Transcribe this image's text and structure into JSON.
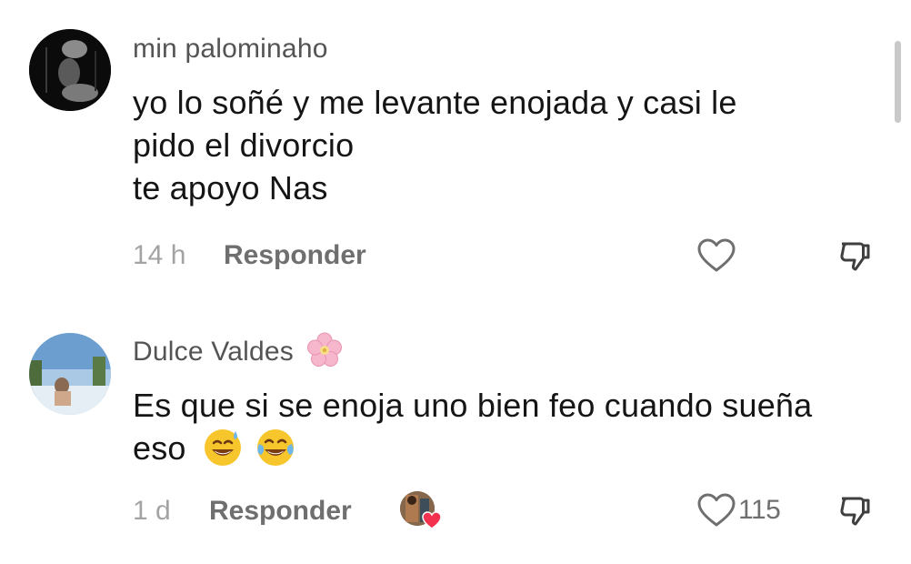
{
  "comments": [
    {
      "username": "min palominaho",
      "lines": [
        "yo lo soñé y me levante enojada y casi le",
        "pido el divorcio",
        "te apoyo Nas"
      ],
      "time": "14 h",
      "reply_label": "Responder",
      "like_count": ""
    },
    {
      "username": "Dulce Valdes",
      "username_emoji": "cherry-blossom-icon",
      "lines": [
        "Es que si se enoja uno bien feo cuando sueña",
        "eso"
      ],
      "line_emojis": [
        "grinning-sweat-emoji",
        "tears-of-joy-emoji"
      ],
      "time": "1 d",
      "reply_label": "Responder",
      "like_count": "115",
      "creator_liked": true
    }
  ],
  "colors": {
    "username": "#545454",
    "body": "#151515",
    "time": "#a3a3a3",
    "reply": "#6f6f6f",
    "heart_badge": "#f2324f",
    "scrollbar": "#c9c9c9"
  }
}
